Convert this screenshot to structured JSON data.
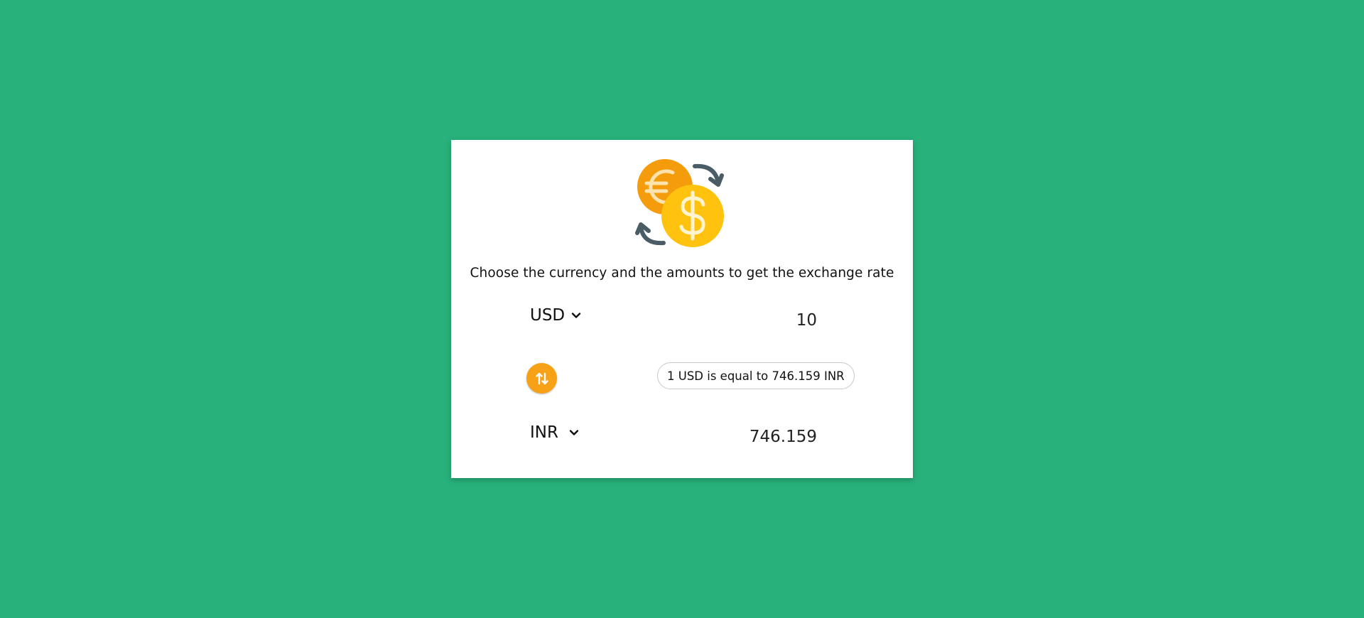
{
  "instructions": "Choose the currency and the amounts to get the exchange rate",
  "from": {
    "currency": "USD",
    "amount": "10"
  },
  "to": {
    "currency": "INR",
    "amount": "746.159"
  },
  "rate_text": "1 USD is equal to 746.159 INR",
  "icons": {
    "logo": "currency-exchange-icon",
    "swap": "swap-vertical-icon",
    "dropdown": "chevron-down-icon"
  },
  "colors": {
    "background": "#28b17b",
    "card": "#ffffff",
    "accent": "#f7a116",
    "euro_coin": "#f49c0c",
    "dollar_coin": "#ffc20e",
    "arrows": "#4a5c66"
  }
}
